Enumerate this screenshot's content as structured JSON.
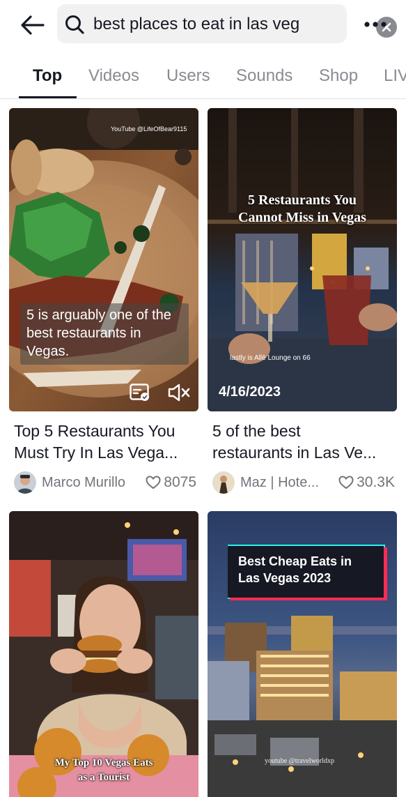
{
  "search": {
    "query": "best places to eat in las veg"
  },
  "tabs": [
    {
      "label": "Top"
    },
    {
      "label": "Videos"
    },
    {
      "label": "Users"
    },
    {
      "label": "Sounds"
    },
    {
      "label": "Shop"
    },
    {
      "label": "LIV"
    }
  ],
  "videos": [
    {
      "watermark": "YouTube @LifeOfBear9115",
      "caption": "5 is arguably one of the best restaurants in Vegas.",
      "title_line1": "Top 5 Restaurants You",
      "title_line2": "Must Try In Las Vega...",
      "author": "Marco Murillo",
      "likes": "8075"
    },
    {
      "headline_line1": "5 Restaurants You",
      "headline_line2": "Cannot Miss in Vegas",
      "caption": "lastly is Allē Lounge on 66",
      "date": "4/16/2023",
      "title_line1": "5 of the best",
      "title_line2": "restaurants in Las Ve...",
      "author": "Maz | Hote...",
      "likes": "30.3K"
    },
    {
      "headline_line1": "My Top 10 Vegas Eats",
      "headline_line2": "as a Tourist"
    },
    {
      "headline_line1": "Best Cheap Eats in",
      "headline_line2": "Las Vegas 2023",
      "watermark": "youtube @travelworldxp"
    }
  ],
  "colors": {
    "text_primary": "#161823",
    "text_secondary": "#73747b",
    "tab_inactive": "#8a8b91",
    "search_bg": "#f1f1f2",
    "badge_pink": "#fe2c55",
    "badge_cyan": "#25f4ee"
  },
  "icons": [
    "back-arrow-icon",
    "search-icon",
    "clear-icon",
    "more-icon",
    "captions-icon",
    "mute-icon",
    "heart-icon"
  ]
}
